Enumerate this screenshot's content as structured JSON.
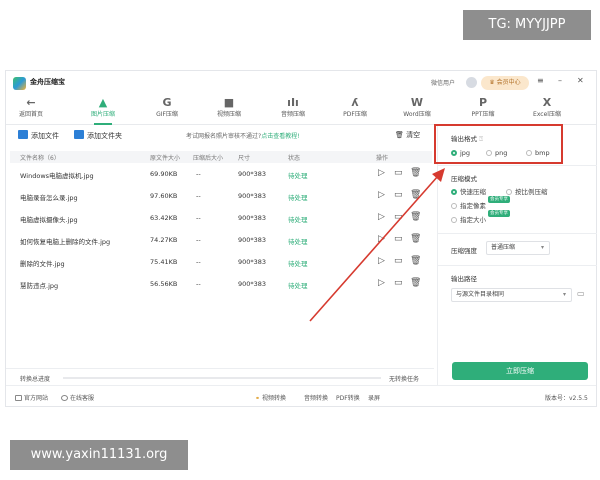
{
  "watermarks": {
    "top": "TG: MYYJJPP",
    "bottom": "www.yaxin11131.org"
  },
  "titlebar": {
    "app_name": "金舟压缩宝",
    "user_label": "微信用户",
    "vip_label": "会员中心",
    "controls": [
      "≡",
      "–",
      "✕"
    ]
  },
  "toolbar": {
    "back_label": "返回首页",
    "tools": [
      {
        "label": "图片压缩",
        "icon": "image-icon",
        "active": true
      },
      {
        "label": "GIF压缩",
        "icon": "gif-icon",
        "active": false
      },
      {
        "label": "视频压缩",
        "icon": "video-icon",
        "active": false
      },
      {
        "label": "音频压缩",
        "icon": "audio-icon",
        "active": false
      },
      {
        "label": "PDF压缩",
        "icon": "pdf-icon",
        "active": false
      },
      {
        "label": "Word压缩",
        "icon": "word-icon",
        "active": false
      },
      {
        "label": "PPT压缩",
        "icon": "ppt-icon",
        "active": false
      },
      {
        "label": "Excel压缩",
        "icon": "excel-icon",
        "active": false
      }
    ]
  },
  "actions": {
    "add_file": "添加文件",
    "add_folder": "添加文件夹",
    "tip": "考试网报名照片审核不通过?",
    "tip_link": "点击查看教程!",
    "clear": "清空"
  },
  "table": {
    "headers": [
      "文件名称（6）",
      "原文件大小",
      "压缩后大小",
      "尺寸",
      "状态",
      "操作"
    ],
    "rows": [
      {
        "name": "Windows电脑虚拟机.jpg",
        "orig": "69.90KB",
        "comp": "--",
        "size": "900*383",
        "status": "待处理"
      },
      {
        "name": "电脑录音怎么录.jpg",
        "orig": "97.60KB",
        "comp": "--",
        "size": "900*383",
        "status": "待处理"
      },
      {
        "name": "电脑虚拟摄像头.jpg",
        "orig": "63.42KB",
        "comp": "--",
        "size": "900*383",
        "status": "待处理"
      },
      {
        "name": "如何恢复电脑上删除的文件.jpg",
        "orig": "74.27KB",
        "comp": "--",
        "size": "900*383",
        "status": "待处理"
      },
      {
        "name": "删除的文件.jpg",
        "orig": "75.41KB",
        "comp": "--",
        "size": "900*383",
        "status": "待处理"
      },
      {
        "name": "慧防违点.jpg",
        "orig": "56.56KB",
        "comp": "--",
        "size": "900*383",
        "status": "待处理"
      }
    ]
  },
  "progress": {
    "label": "转换总进度",
    "status": "无转换任务",
    "fraction": 0
  },
  "settings": {
    "output_format": {
      "title": "输出格式",
      "options": [
        {
          "label": "jpg",
          "checked": true
        },
        {
          "label": "png",
          "checked": false
        },
        {
          "label": "bmp",
          "checked": false
        }
      ]
    },
    "compress_mode": {
      "title": "压缩模式",
      "options": [
        {
          "label": "快速压缩",
          "checked": true
        },
        {
          "label": "按比例压缩",
          "checked": false
        },
        {
          "label": "指定像素",
          "checked": false,
          "badge": "会员专享"
        },
        {
          "label": "指定大小",
          "checked": false,
          "badge": "会员专享"
        }
      ]
    },
    "strength": {
      "title": "压缩强度",
      "value": "普通压缩"
    },
    "output_path": {
      "title": "输出路径",
      "value": "与源文件目录相同"
    },
    "compress_button": "立即压缩"
  },
  "statusbar": {
    "official_site": "官方网站",
    "online_support": "在线客服",
    "links": [
      "视频转换",
      "音频转换",
      "PDF转换",
      "录屏"
    ],
    "version": "版本号：v2.5.5"
  },
  "colors": {
    "accent": "#2fae7a",
    "highlight": "#d63a2f",
    "vip": "#fbe7cc"
  }
}
